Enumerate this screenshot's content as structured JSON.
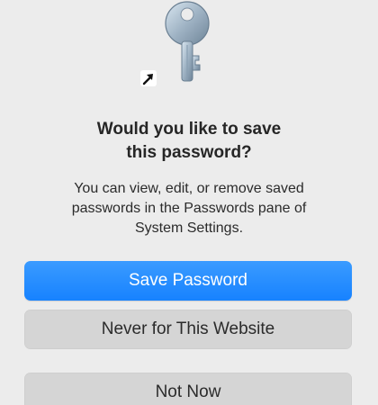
{
  "dialog": {
    "icon": "key-icon",
    "badge_icon": "alias-arrow-icon",
    "title_line1": "Would you like to save",
    "title_line2": "this password?",
    "message_line1": "You can view, edit, or remove saved",
    "message_line2": "passwords in the Passwords pane of",
    "message_line3": "System Settings.",
    "buttons": {
      "save": "Save Password",
      "never": "Never for This Website",
      "not_now": "Not Now"
    }
  },
  "colors": {
    "primary": "#1f86ff",
    "secondary": "#d5d5d5",
    "background": "#ececec"
  }
}
